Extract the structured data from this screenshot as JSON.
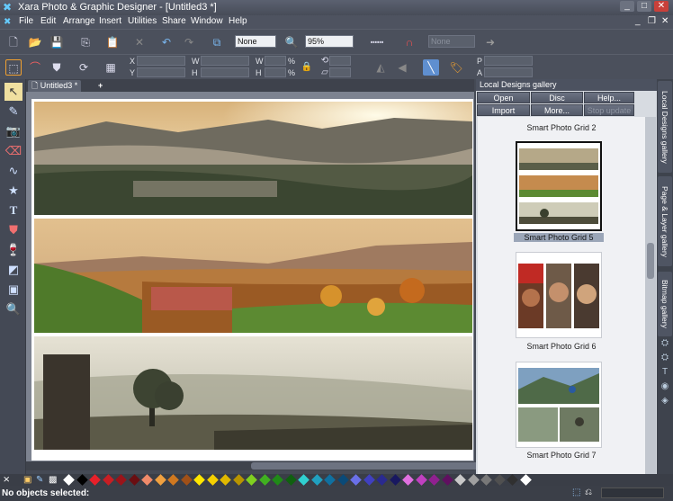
{
  "app": {
    "title": "Xara Photo & Graphic Designer - [Untitled3 *]",
    "window_buttons": [
      "_",
      "□",
      "✕"
    ]
  },
  "menu": [
    "File",
    "Edit",
    "Arrange",
    "Insert",
    "Utilities",
    "Share",
    "Window",
    "Help"
  ],
  "toolbar": {
    "quality_value": "None",
    "zoom_value": "95%",
    "disabled_field": "None"
  },
  "infobar": {
    "x_label": "X",
    "y_label": "Y",
    "w_label": "W",
    "h_label": "H",
    "w2_label": "W",
    "h2_label": "H",
    "pct": "%",
    "p_label": "P",
    "a_label": "A"
  },
  "document_tab": {
    "label": "Untitled3 *",
    "add": "+"
  },
  "gallery": {
    "header": "Local Designs gallery",
    "buttons": {
      "open": "Open",
      "disc_designs": "Disc designs...",
      "help": "Help...",
      "import": "Import",
      "more": "More...",
      "stop_update": "Stop update"
    },
    "items": [
      {
        "name": "Smart Photo Grid 2"
      },
      {
        "name": "Smart Photo Grid 5",
        "selected": true
      },
      {
        "name": "Smart Photo Grid 6"
      },
      {
        "name": "Smart Photo Grid 7"
      }
    ]
  },
  "rail_tabs": [
    "Local Designs gallery",
    "Page & Layer gallery",
    "Bitmap gallery"
  ],
  "status": {
    "text": "No objects selected:"
  },
  "palette_colors": [
    "#ffffff",
    "#000000",
    "#e8202a",
    "#c81e24",
    "#9a141a",
    "#6a0e12",
    "#f08a6a",
    "#f0a040",
    "#d07820",
    "#a05018",
    "#ffe600",
    "#f5d000",
    "#e0b800",
    "#b89400",
    "#80d020",
    "#40b020",
    "#208a18",
    "#106010",
    "#30d0d0",
    "#20a0c0",
    "#1070a0",
    "#0a4a78",
    "#6a70e8",
    "#4040c0",
    "#2a2a90",
    "#181860",
    "#e070e0",
    "#c040c0",
    "#902090",
    "#601060",
    "#c8c8c8",
    "#a0a0a0",
    "#787878",
    "#505050",
    "#303030",
    "#ffffff"
  ]
}
